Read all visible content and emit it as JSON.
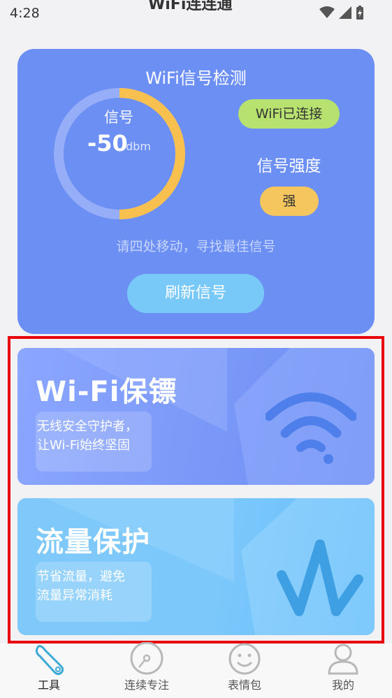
{
  "status_bar": {
    "time": "4:28",
    "title": "WiFi连连通"
  },
  "signal_card": {
    "title": "WiFi信号检测",
    "gauge_label": "信号",
    "signal_value": "-50",
    "signal_unit": "dbm",
    "signal_fill_fraction": 0.5,
    "connected_badge": "WiFi已连接",
    "strength_label": "信号强度",
    "strength_value": "强",
    "hint": "请四处移动，寻找最佳信号",
    "refresh_button": "刷新信号"
  },
  "features": [
    {
      "title": "Wi-Fi保镖",
      "desc_line1": "无线安全守护者，",
      "desc_line2": "让Wi-Fi始终坚固",
      "icon": "wifi-icon"
    },
    {
      "title": "流量保护",
      "desc_line1": "节省流量，避免",
      "desc_line2": "流量异常消耗",
      "icon": "waveform-icon"
    }
  ],
  "nav": [
    {
      "label": "工具",
      "icon": "wrench-icon",
      "active": true
    },
    {
      "label": "连续专注",
      "icon": "disc-icon",
      "active": false
    },
    {
      "label": "表情包",
      "icon": "smiley-icon",
      "active": false
    },
    {
      "label": "我的",
      "icon": "user-icon",
      "active": false
    }
  ],
  "colors": {
    "signal_card": "#6b8ff3",
    "gauge_fill": "#f7c04f",
    "connected": "#b7e26f",
    "strong": "#f6c65e",
    "refresh": "#79c9f8",
    "highlight": "#e8000b"
  }
}
